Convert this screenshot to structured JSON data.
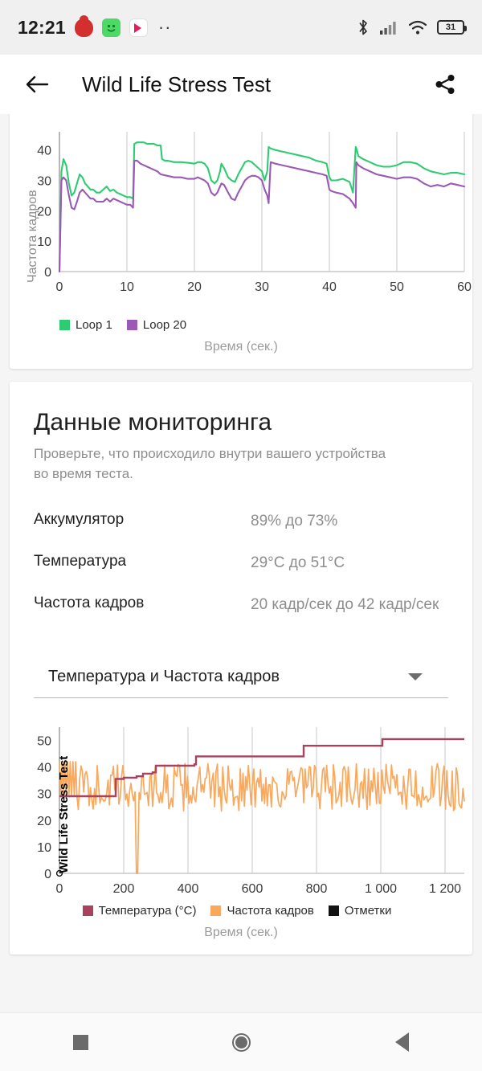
{
  "status_bar": {
    "time": "12:21",
    "battery_percent": "31",
    "icons": [
      "fire-app-icon",
      "green-app-icon",
      "play-app-icon",
      "overflow-dots-icon",
      "bluetooth-icon",
      "cellular-signal-icon",
      "wifi-icon",
      "battery-icon"
    ]
  },
  "app_bar": {
    "back_label": "←",
    "title": "Wild Life Stress Test",
    "share_label": "share-icon"
  },
  "monitoring": {
    "title": "Данные мониторинга",
    "subtitle": "Проверьте, что происходило внутри вашего устройства во время теста.",
    "rows": [
      {
        "key": "Аккумулятор",
        "value": "89% до 73%"
      },
      {
        "key": "Температура",
        "value": "29°C до 51°C"
      },
      {
        "key": "Частота кадров",
        "value": "20 кадр/сек до 42 кадр/сек"
      }
    ],
    "selector": {
      "value": "Температура и Частота кадров"
    }
  },
  "colors": {
    "loop1_green": "#2ecc71",
    "loop20_purple": "#9b59b6",
    "temperature_red": "#a8435e",
    "framerate_orange": "#f9a85c",
    "marks_black": "#111111",
    "grid": "#c9c9c9",
    "axis_text": "#3a3a3a",
    "caption_text": "#9b9b9b"
  },
  "chart_data": [
    {
      "type": "line",
      "title": "",
      "xlabel": "Время (сек.)",
      "ylabel": "Частота кадров",
      "xlim": [
        0,
        60
      ],
      "ylim": [
        0,
        46
      ],
      "xticks": [
        0,
        10,
        20,
        30,
        40,
        50,
        60
      ],
      "yticks": [
        0,
        10,
        20,
        30,
        40
      ],
      "grid": true,
      "legend_position": "bottom-left",
      "series": [
        {
          "name": "Loop 1",
          "color": "#2ecc71",
          "x": [
            0,
            0.3,
            0.6,
            1,
            1.4,
            1.8,
            2.2,
            2.6,
            3,
            3.4,
            3.8,
            4.2,
            4.6,
            5,
            5.5,
            6,
            6.5,
            7,
            7.5,
            8,
            8.5,
            9,
            9.5,
            10,
            10.5,
            10.9,
            11.1,
            11.5,
            12,
            12.5,
            13,
            13.5,
            14,
            14.5,
            15,
            15.2,
            15.6,
            16,
            17,
            18,
            19,
            20,
            20.5,
            21,
            21.5,
            22,
            22.5,
            23,
            23.4,
            23.8,
            24,
            24.4,
            25,
            25.5,
            26,
            26.5,
            27,
            27.5,
            28,
            28.5,
            29,
            29.5,
            30,
            30.4,
            30.8,
            31,
            31.3,
            32,
            33,
            34,
            35,
            36,
            37,
            38,
            39,
            39.6,
            40,
            40.3,
            41,
            42,
            43,
            43.5,
            43.9,
            44,
            44.3,
            45,
            46,
            47,
            48,
            49,
            50,
            51,
            52,
            53,
            54,
            55,
            56,
            57,
            58,
            59,
            60
          ],
          "y": [
            0,
            33,
            37,
            35,
            29,
            25,
            26,
            29,
            32,
            31,
            29,
            28,
            27,
            27,
            26,
            26,
            27,
            28,
            26.5,
            27,
            26,
            25.5,
            25,
            24.5,
            24.5,
            24,
            42,
            42.5,
            42.5,
            42.5,
            42,
            42,
            42,
            41.5,
            41.5,
            37,
            36.5,
            36.5,
            36,
            36,
            35.8,
            35.5,
            36,
            36,
            35.5,
            34,
            30,
            29,
            30,
            33,
            35.5,
            34,
            31,
            30,
            29.5,
            32,
            34,
            36,
            36.5,
            36,
            35,
            34,
            33,
            30,
            33,
            41,
            40.5,
            40,
            39.5,
            39,
            38.5,
            38,
            37.5,
            36.5,
            36,
            35.5,
            31,
            30,
            30,
            30.5,
            29.5,
            26,
            41,
            40.5,
            38,
            37,
            36,
            35,
            34.5,
            34.5,
            35,
            36,
            36,
            35.5,
            34,
            33,
            32.5,
            32,
            32.5,
            32.5,
            32
          ]
        },
        {
          "name": "Loop 20",
          "color": "#9b59b6",
          "x": [
            0,
            0.3,
            0.6,
            1,
            1.4,
            1.8,
            2.2,
            2.6,
            3,
            3.4,
            3.8,
            4.2,
            4.6,
            5,
            5.5,
            6,
            6.5,
            7,
            7.5,
            8,
            8.5,
            9,
            9.5,
            10,
            10.5,
            10.9,
            11.1,
            11.5,
            12,
            12.5,
            13,
            13.5,
            14,
            14.5,
            15,
            16,
            17,
            18,
            19,
            20,
            20.5,
            21,
            21.5,
            22,
            22.5,
            23,
            23.4,
            23.8,
            24,
            24.4,
            25,
            25.5,
            26,
            26.5,
            27,
            27.5,
            28,
            28.5,
            29,
            29.5,
            30,
            30.4,
            30.8,
            31,
            31.3,
            32,
            33,
            34,
            35,
            36,
            37,
            38,
            39,
            39.6,
            40,
            40.3,
            41,
            42,
            43,
            43.5,
            43.9,
            44,
            44.3,
            45,
            46,
            47,
            48,
            49,
            50,
            51,
            52,
            53,
            54,
            55,
            56,
            57,
            58,
            59,
            60
          ],
          "y": [
            0,
            30,
            31,
            30,
            25,
            21,
            20.5,
            23,
            26,
            27,
            26,
            25,
            24,
            24,
            23,
            23,
            23,
            24,
            23,
            24,
            23.5,
            23,
            22.5,
            22,
            22,
            21,
            36.5,
            36.5,
            35.5,
            35,
            34.5,
            34,
            33.5,
            33,
            32,
            31.5,
            31,
            31,
            30.5,
            30.5,
            31,
            30.5,
            30,
            29,
            26,
            25,
            26,
            28,
            29,
            28.5,
            26,
            24,
            23.5,
            26,
            28,
            30,
            31,
            31.5,
            31.5,
            31,
            30,
            27,
            25,
            22.5,
            36,
            35.5,
            35,
            34.5,
            34,
            33.5,
            33,
            32.5,
            32,
            31.5,
            27,
            26.5,
            26,
            25.5,
            24,
            22.5,
            21,
            36,
            35,
            34,
            33,
            32,
            31.5,
            31,
            30.5,
            31,
            31,
            30.5,
            29,
            28,
            28.5,
            28,
            29,
            28.5,
            28
          ]
        }
      ]
    },
    {
      "type": "line",
      "title": "",
      "xlabel": "Время (сек.)",
      "ylabel": "",
      "annotation": "Wild Life Stress Test",
      "xlim": [
        0,
        1260
      ],
      "ylim": [
        0,
        55
      ],
      "xticks": [
        0,
        200,
        400,
        600,
        800,
        1000,
        1200
      ],
      "xtick_labels": [
        "0",
        "200",
        "400",
        "600",
        "800",
        "1 000",
        "1 200"
      ],
      "yticks": [
        0,
        10,
        20,
        30,
        40,
        50
      ],
      "grid": true,
      "legend_position": "bottom-center",
      "series": [
        {
          "name": "Температура (°C)",
          "color": "#a8435e",
          "type": "step",
          "x": [
            0,
            170,
            175,
            200,
            240,
            260,
            290,
            300,
            420,
            425,
            755,
            760,
            1000,
            1005,
            1260
          ],
          "y": [
            29,
            29,
            35.5,
            36,
            36.5,
            37.5,
            38,
            40.5,
            41,
            44,
            44,
            48,
            48,
            50.5,
            50.5
          ]
        },
        {
          "name": "Частота кадров",
          "color": "#f9a85c",
          "type": "noisy",
          "mean": 32,
          "amplitude": 9,
          "dropouts": [
            {
              "x": 240,
              "y": 0
            }
          ],
          "range": [
            20,
            42
          ]
        },
        {
          "name": "Отметки",
          "color": "#111111",
          "type": "marks",
          "x": [
            0
          ],
          "y": [
            0
          ]
        }
      ]
    }
  ]
}
